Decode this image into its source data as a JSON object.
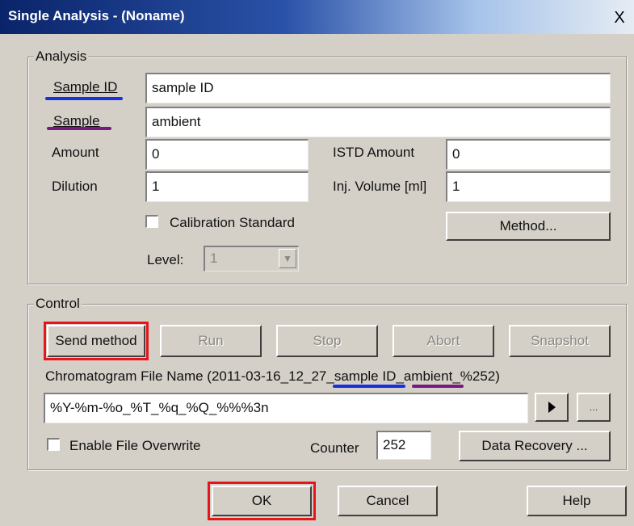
{
  "window": {
    "title": "Single Analysis - (Noname)",
    "close_glyph": "X"
  },
  "analysis": {
    "legend": "Analysis",
    "sample_id_label": "Sample ID",
    "sample_id_value": "sample ID",
    "sample_label": "Sample",
    "sample_value": "ambient",
    "amount_label": "Amount",
    "amount_value": "0",
    "istd_amount_label": "ISTD Amount",
    "istd_amount_value": "0",
    "dilution_label": "Dilution",
    "dilution_value": "1",
    "inj_volume_label": "Inj. Volume [ml]",
    "inj_volume_value": "1",
    "calibration_label": "Calibration Standard",
    "calibration_checked": false,
    "level_label": "Level:",
    "level_value": "1",
    "method_button": "Method..."
  },
  "control": {
    "legend": "Control",
    "send_method": "Send method",
    "run": "Run",
    "stop": "Stop",
    "abort": "Abort",
    "snapshot": "Snapshot",
    "filename_caption": {
      "prefix": "Chromatogram File Name (2011-03-16_12_27_",
      "sample_id": "sample ID",
      "sep": "_",
      "sample": "ambient",
      "suffix": "_%252)"
    },
    "filename_value": "%Y-%m-%o_%T_%q_%Q_%%%3n",
    "play_icon": "play-icon",
    "browse_button": "...",
    "overwrite_label": "Enable File Overwrite",
    "overwrite_checked": false,
    "counter_label": "Counter",
    "counter_value": "252",
    "data_recovery": "Data Recovery ..."
  },
  "footer": {
    "ok": "OK",
    "cancel": "Cancel",
    "help": "Help"
  },
  "annotations": {
    "highlight_color": "#e8141c",
    "sample_id_color": "#1a2fe0",
    "sample_color": "#7a1a7c"
  }
}
